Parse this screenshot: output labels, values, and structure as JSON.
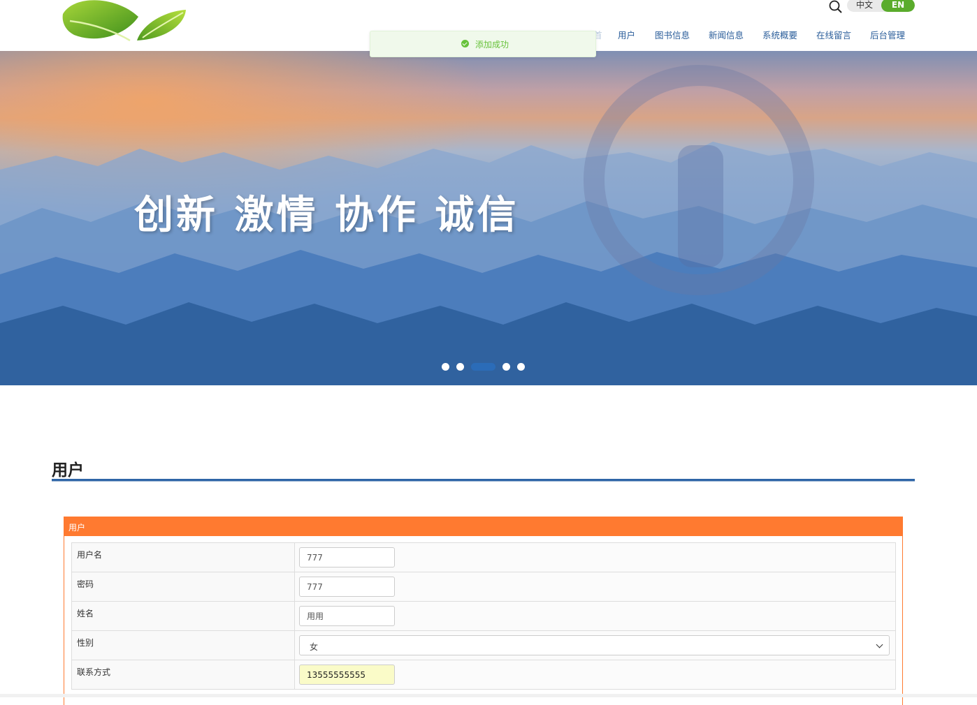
{
  "header": {
    "lang_zh": "中文",
    "lang_en": "EN",
    "nav": [
      "用户",
      "图书信息",
      "新闻信息",
      "系统概要",
      "在线留言",
      "后台管理"
    ],
    "nav_partial": "首"
  },
  "toast": {
    "message": "添加成功",
    "icon": "check-circle-icon"
  },
  "banner": {
    "slogan": "创新 激情  协作 诚信",
    "carousel_slides": 5,
    "active_slide": 3
  },
  "section": {
    "title": "用户"
  },
  "form": {
    "panel_title": "用户",
    "rows": [
      {
        "label": "用户名",
        "value": "777"
      },
      {
        "label": "密码",
        "value": "777"
      },
      {
        "label": "姓名",
        "value": "用用"
      },
      {
        "label": "性别",
        "selected": "女"
      },
      {
        "label": "联系方式",
        "value": "13555555555"
      }
    ]
  },
  "colors": {
    "nav_text": "#2a5d9a",
    "accent_orange": "#ff7a30",
    "section_line": "#2f66a7",
    "lang_active": "#5aac2c",
    "success": "#67c23a"
  }
}
